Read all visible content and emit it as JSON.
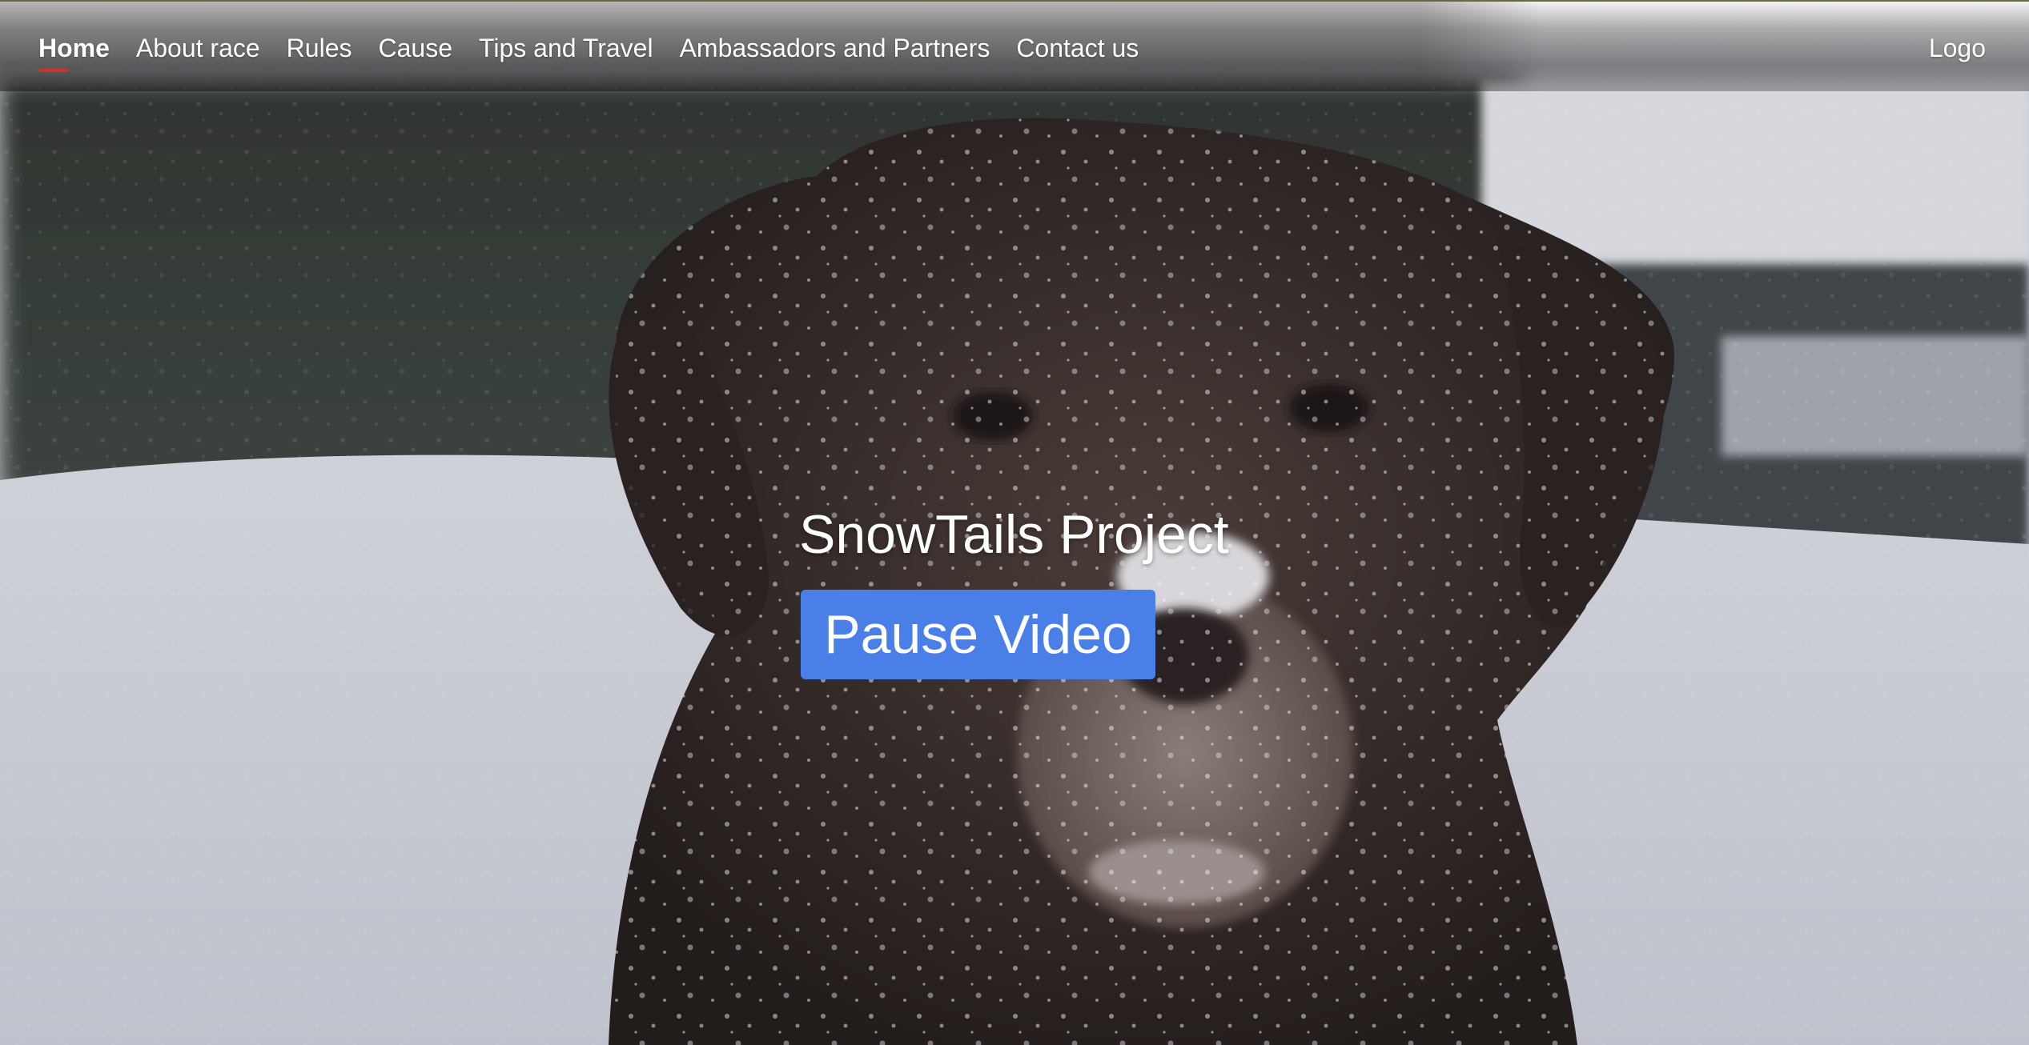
{
  "nav": {
    "items": [
      {
        "label": "Home",
        "active": true
      },
      {
        "label": "About race",
        "active": false
      },
      {
        "label": "Rules",
        "active": false
      },
      {
        "label": "Cause",
        "active": false
      },
      {
        "label": "Tips and Travel",
        "active": false
      },
      {
        "label": "Ambassadors and Partners",
        "active": false
      },
      {
        "label": "Contact us",
        "active": false
      }
    ],
    "logo": "Logo"
  },
  "hero": {
    "title": "SnowTails Project",
    "button_label": "Pause Video"
  },
  "colors": {
    "accent_button": "#4b7fe8",
    "active_underline": "#d0312d"
  }
}
